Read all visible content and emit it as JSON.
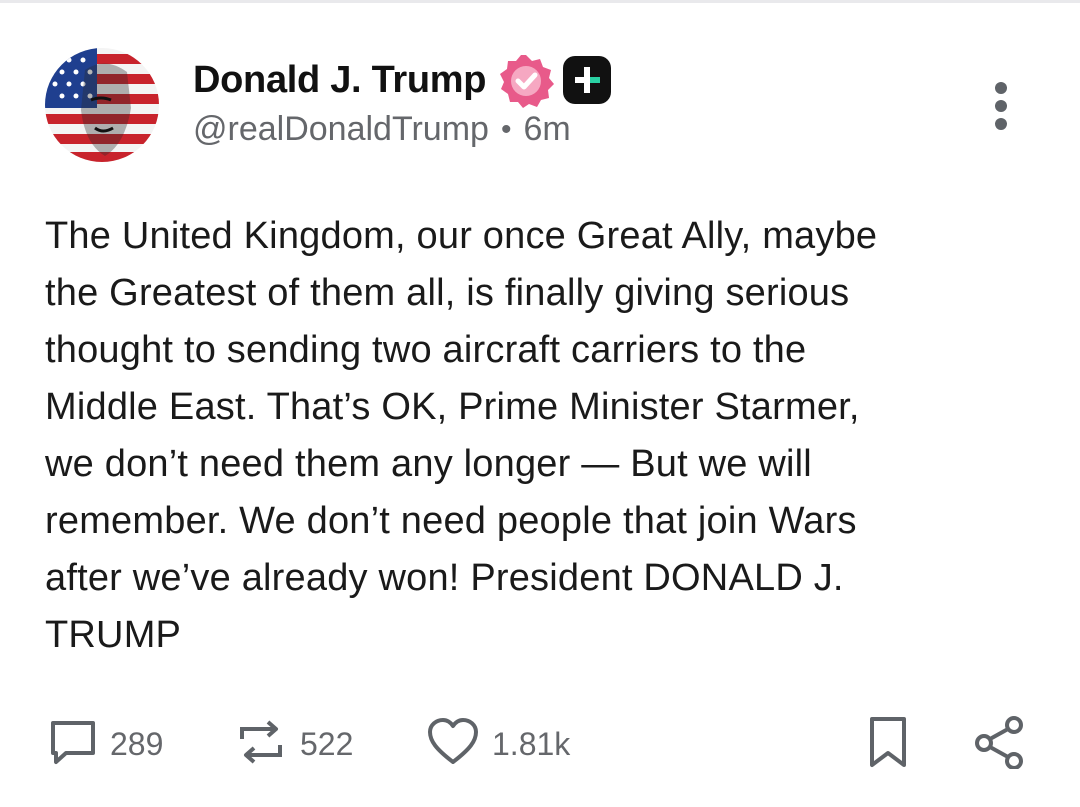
{
  "post": {
    "author": {
      "display_name": "Donald J. Trump",
      "handle": "@realDonaldTrump",
      "verified_badge_color": "#e85a8a"
    },
    "time_ago": "6m",
    "meta_separator": "•",
    "body": "The United Kingdom, our once Great Ally, maybe\nthe Greatest of them all, is finally giving serious\nthought to sending two aircraft carriers to the\nMiddle East. That’s OK, Prime Minister Starmer,\nwe don’t need them any longer — But we will\nremember. We don’t need people that join Wars\nafter we’ve already won! President DONALD J.\nTRUMP",
    "actions": {
      "reply_count": "289",
      "retruth_count": "522",
      "like_count": "1.81k"
    },
    "icons": {
      "reply": "speech-bubble-icon",
      "retruth": "repost-arrows-icon",
      "like": "heart-icon",
      "bookmark": "bookmark-icon",
      "share": "share-icon",
      "more": "vertical-ellipsis-icon",
      "plus": "plus-badge-icon"
    },
    "colors": {
      "text": "#1a1a1a",
      "muted": "#65676b",
      "icon_gray": "#5f6368"
    }
  }
}
